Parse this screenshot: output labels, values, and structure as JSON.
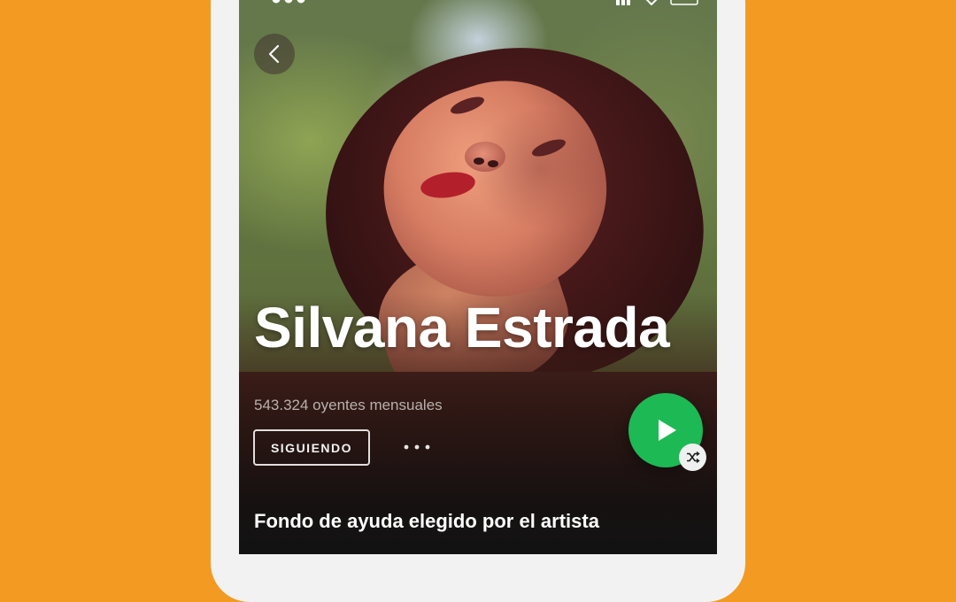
{
  "artist": {
    "name": "Silvana Estrada",
    "monthly_listeners": "543.324 oyentes mensuales"
  },
  "actions": {
    "follow_label": "SIGUIENDO",
    "more_label": "•••"
  },
  "section": {
    "title": "Fondo de ayuda elegido por el artista"
  },
  "colors": {
    "background": "#f39a22",
    "play_button": "#1db954",
    "panel": "#121212"
  },
  "icons": {
    "back": "chevron-left-icon",
    "play": "play-icon",
    "shuffle": "shuffle-icon",
    "more": "more-options-icon"
  }
}
